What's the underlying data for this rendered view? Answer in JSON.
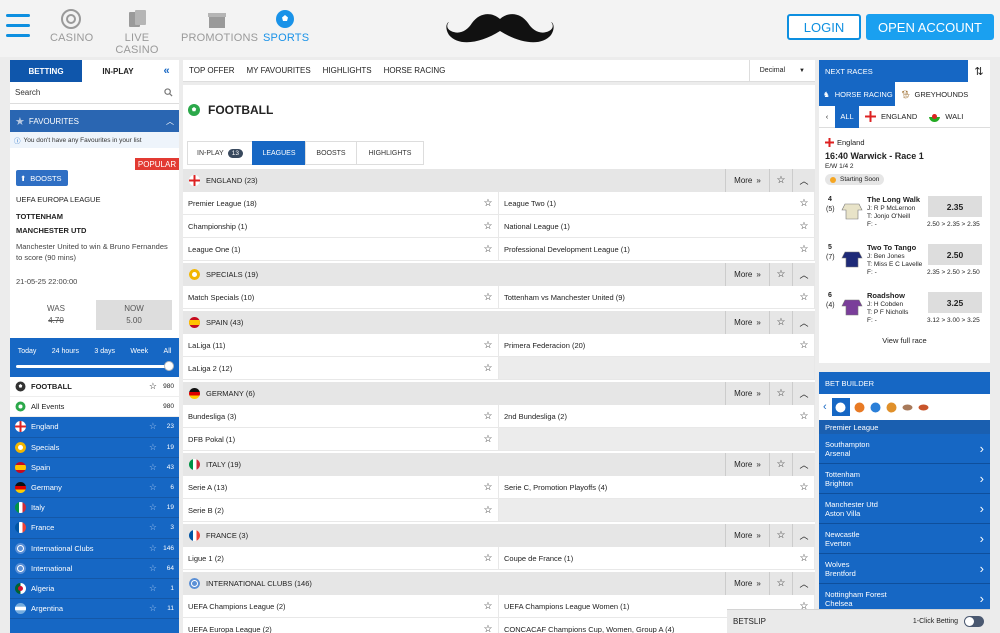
{
  "header": {
    "nav": [
      {
        "label": "CASINO"
      },
      {
        "label": "LIVE CASINO"
      },
      {
        "label": "PROMOTIONS"
      },
      {
        "label": "SPORTS"
      }
    ],
    "login": "LOGIN",
    "open_account": "OPEN ACCOUNT",
    "accent": "#1992e8"
  },
  "left": {
    "tabs": [
      "BETTING",
      "IN-PLAY"
    ],
    "search": "Search",
    "favourites": "FAVOURITES",
    "fav_info": "You don't have any Favourites in your list",
    "popular": "POPULAR",
    "boosts": "BOOSTS",
    "competition": "UEFA EUROPA LEAGUE",
    "team1": "TOTTENHAM",
    "team2": "MANCHESTER UTD",
    "desc": "Manchester United to win & Bruno Fernandes to score (90 mins)",
    "datetime": "21-05-25 22:00:00",
    "was_label": "WAS",
    "was_val": "4.70",
    "now_label": "NOW",
    "now_val": "5.00",
    "time_filters": [
      "Today",
      "24 hours",
      "3 days",
      "Week",
      "All"
    ],
    "sport": {
      "name": "FOOTBALL",
      "count": "980"
    },
    "all_events": {
      "name": "All Events",
      "count": "980"
    },
    "items": [
      {
        "name": "England",
        "count": "23"
      },
      {
        "name": "Specials",
        "count": "19"
      },
      {
        "name": "Spain",
        "count": "43"
      },
      {
        "name": "Germany",
        "count": "6"
      },
      {
        "name": "Italy",
        "count": "19"
      },
      {
        "name": "France",
        "count": "3"
      },
      {
        "name": "International Clubs",
        "count": "146"
      },
      {
        "name": "International",
        "count": "64"
      },
      {
        "name": "Algeria",
        "count": "1"
      },
      {
        "name": "Argentina",
        "count": "11"
      }
    ]
  },
  "middle": {
    "topnav": [
      "TOP OFFER",
      "MY FAVOURITES",
      "HIGHLIGHTS",
      "HORSE RACING"
    ],
    "odds_format": "Decimal",
    "title": "FOOTBALL",
    "subtabs": {
      "inplay": "IN-PLAY",
      "inplay_count": "13",
      "leagues": "LEAGUES",
      "boosts": "BOOSTS",
      "highlights": "HIGHLIGHTS"
    },
    "more": "More",
    "groups": [
      {
        "title": "ENGLAND (23)",
        "flag": "england",
        "items": [
          "Premier League (18)",
          "League Two (1)",
          "Championship (1)",
          "National League (1)",
          "League One (1)",
          "Professional Development League (1)"
        ]
      },
      {
        "title": "SPECIALS (19)",
        "flag": "specials",
        "items": [
          "Match Specials (10)",
          "Tottenham vs Manchester United (9)"
        ]
      },
      {
        "title": "SPAIN (43)",
        "flag": "spain",
        "items": [
          "LaLiga (11)",
          "Primera Federacion (20)",
          "LaLiga 2 (12)"
        ]
      },
      {
        "title": "GERMANY (6)",
        "flag": "germany",
        "items": [
          "Bundesliga (3)",
          "2nd Bundesliga (2)",
          "DFB Pokal (1)"
        ]
      },
      {
        "title": "ITALY (19)",
        "flag": "italy",
        "items": [
          "Serie A (13)",
          "Serie C, Promotion Playoffs (4)",
          "Serie B (2)"
        ]
      },
      {
        "title": "FRANCE (3)",
        "flag": "france",
        "items": [
          "Ligue 1 (2)",
          "Coupe de France (1)"
        ]
      },
      {
        "title": "INTERNATIONAL CLUBS (146)",
        "flag": "intl",
        "items": [
          "UEFA Champions League (2)",
          "UEFA Champions League Women (1)",
          "UEFA Europa League (2)",
          "CONCACAF Champions Cup, Women, Group A (4)"
        ]
      }
    ]
  },
  "right": {
    "next_races": "NEXT RACES",
    "horse": "HORSE RACING",
    "grey": "GREYHOUNDS",
    "filters": [
      "ALL",
      "ENGLAND",
      "WALI"
    ],
    "country": "England",
    "race": "16:40 Warwick - Race 1",
    "ew": "E/W 1/4 2",
    "status": "Starting Soon",
    "runners": [
      {
        "num": "4",
        "draw": "(5)",
        "name": "The Long Walk",
        "jockey": "J: R P McLernon",
        "trainer": "T: Jonjo O'Neill",
        "form": "F: -",
        "odds": "2.35",
        "prev": "2.50 > 2.35 > 2.35"
      },
      {
        "num": "5",
        "draw": "(7)",
        "name": "Two To Tango",
        "jockey": "J: Ben Jones",
        "trainer": "T: Miss E C Lavelle",
        "form": "F: -",
        "odds": "2.50",
        "prev": "2.35 > 2.50 > 2.50"
      },
      {
        "num": "6",
        "draw": "(4)",
        "name": "Roadshow",
        "jockey": "J: H Cobden",
        "trainer": "T: P F Nicholls",
        "form": "F: -",
        "odds": "3.25",
        "prev": "3.12 > 3.00 > 3.25"
      }
    ],
    "view_full": "View full race",
    "bet_builder": "BET BUILDER",
    "league": "Premier League",
    "matches": [
      [
        "Southampton",
        "Arsenal"
      ],
      [
        "Tottenham",
        "Brighton"
      ],
      [
        "Manchester Utd",
        "Aston Villa"
      ],
      [
        "Newcastle",
        "Everton"
      ],
      [
        "Wolves",
        "Brentford"
      ],
      [
        "Nottingham Forest",
        "Chelsea"
      ]
    ]
  },
  "betslip": {
    "label": "BETSLIP",
    "one_click": "1-Click Betting"
  }
}
